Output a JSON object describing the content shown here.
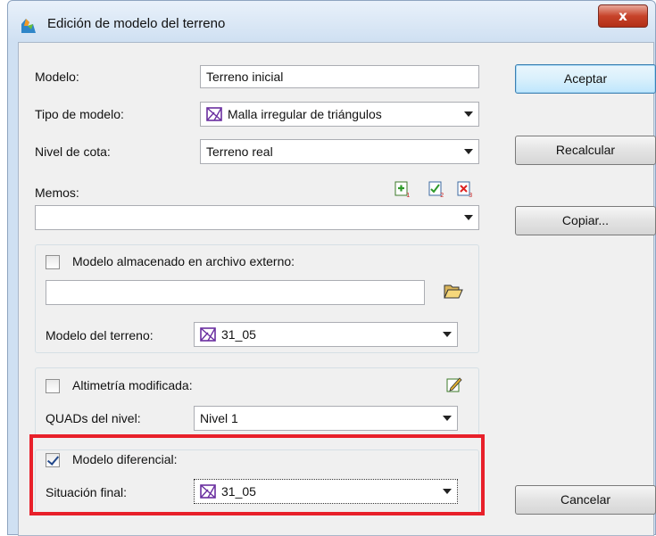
{
  "window": {
    "title": "Edición de modelo del terreno",
    "close_label": "x"
  },
  "form": {
    "modelo_label": "Modelo:",
    "modelo_value": "Terreno inicial",
    "tipo_label": "Tipo de modelo:",
    "tipo_value": "Malla irregular de triángulos",
    "nivel_label": "Nivel de cota:",
    "nivel_value": "Terreno real",
    "memos_label": "Memos:",
    "memos_value": ""
  },
  "external": {
    "checkbox_label": "Modelo almacenado en archivo externo:",
    "checked": false,
    "path_value": "",
    "modelo_terreno_label": "Modelo del terreno:",
    "modelo_terreno_value": "31_05"
  },
  "altimetria": {
    "checkbox_label": "Altimetría modificada:",
    "checked": false,
    "quads_label": "QUADs del nivel:",
    "quads_value": "Nivel 1"
  },
  "diferencial": {
    "checkbox_label": "Modelo diferencial:",
    "checked": true,
    "situacion_label": "Situación final:",
    "situacion_value": "31_05"
  },
  "buttons": {
    "aceptar": "Aceptar",
    "recalcular": "Recalcular",
    "copiar": "Copiar...",
    "cancelar": "Cancelar"
  },
  "icons": {
    "memo_add": "memo-add-icon",
    "memo_edit": "memo-edit-icon",
    "memo_delete": "memo-delete-icon",
    "folder_open": "folder-open-icon",
    "edit_pencil": "edit-pencil-icon",
    "triangle_mesh": "triangle-mesh-icon"
  },
  "colors": {
    "highlight": "#e8202a",
    "accent": "#3c7fb1"
  }
}
